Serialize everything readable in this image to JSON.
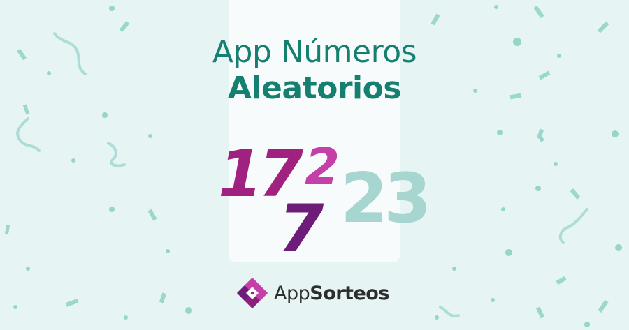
{
  "title": {
    "line1": "App Números",
    "line2": "Aleatorios"
  },
  "numbers": {
    "n1": "17",
    "n2": "2",
    "n3": "7",
    "n4": "23"
  },
  "brand": {
    "part1": "App",
    "part2": "Sorteos",
    "icon": "appsorteos-logo-icon"
  },
  "colors": {
    "background": "#e6f4f3",
    "card": "#f8fbfb",
    "title": "#15806f",
    "magenta": "#a0217f",
    "pink": "#c53fa8",
    "purple": "#6e1c7a",
    "mint": "#a7d5cf",
    "confetti": "#7ccbbd"
  }
}
